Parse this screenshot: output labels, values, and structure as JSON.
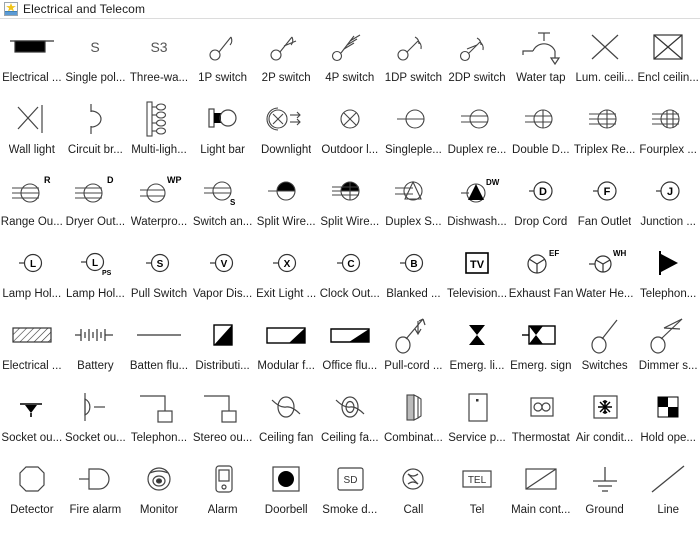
{
  "window": {
    "title": "Electrical and Telecom",
    "icon": "library-star-icon"
  },
  "colors": {
    "stroke": "#3a3a3a",
    "fill_black": "#000000",
    "text": "#1d1d1d",
    "accent_star": "#f0c419",
    "accent_band": "#5b9bd5"
  },
  "palette": {
    "columns": 11,
    "rows": 7,
    "items": [
      {
        "label": "Electrical ...",
        "icon": "electrical-panel-icon"
      },
      {
        "label": "Single pol...",
        "icon": "single-pole-switch-s-icon"
      },
      {
        "label": "Three-wa...",
        "icon": "three-way-switch-s3-icon"
      },
      {
        "label": "1P switch",
        "icon": "1p-switch-icon"
      },
      {
        "label": "2P switch",
        "icon": "2p-switch-icon"
      },
      {
        "label": "4P switch",
        "icon": "4p-switch-icon"
      },
      {
        "label": "1DP switch",
        "icon": "1dp-switch-icon"
      },
      {
        "label": "2DP switch",
        "icon": "2dp-switch-icon"
      },
      {
        "label": "Water tap",
        "icon": "water-tap-icon"
      },
      {
        "label": "Lum. ceili...",
        "icon": "luminaire-ceiling-icon"
      },
      {
        "label": "Encl ceilin...",
        "icon": "enclosed-ceiling-icon"
      },
      {
        "label": "Wall light",
        "icon": "wall-light-icon"
      },
      {
        "label": "Circuit br...",
        "icon": "circuit-breaker-icon"
      },
      {
        "label": "Multi-ligh...",
        "icon": "multi-light-track-icon"
      },
      {
        "label": "Light bar",
        "icon": "light-bar-icon"
      },
      {
        "label": "Downlight",
        "icon": "downlight-icon"
      },
      {
        "label": "Outdoor l...",
        "icon": "outdoor-light-icon"
      },
      {
        "label": "Singleple...",
        "icon": "single-receptacle-icon"
      },
      {
        "label": "Duplex re...",
        "icon": "duplex-receptacle-icon"
      },
      {
        "label": "Double D...",
        "icon": "double-duplex-receptacle-icon"
      },
      {
        "label": "Triplex Re...",
        "icon": "triplex-receptacle-icon"
      },
      {
        "label": "Fourplex ...",
        "icon": "fourplex-receptacle-icon"
      },
      {
        "label": "Range Ou...",
        "icon": "range-outlet-r-icon"
      },
      {
        "label": "Dryer Out...",
        "icon": "dryer-outlet-d-icon"
      },
      {
        "label": "Waterpro...",
        "icon": "waterproof-outlet-wp-icon"
      },
      {
        "label": "Switch an...",
        "icon": "switch-and-outlet-s-icon"
      },
      {
        "label": "Split Wire...",
        "icon": "split-wired-duplex-icon"
      },
      {
        "label": "Split Wire...",
        "icon": "split-wired-triplex-icon"
      },
      {
        "label": "Duplex S...",
        "icon": "duplex-special-triangle-icon"
      },
      {
        "label": "Dishwash...",
        "icon": "dishwasher-dw-icon"
      },
      {
        "label": "Drop Cord",
        "icon": "drop-cord-d-icon"
      },
      {
        "label": "Fan Outlet",
        "icon": "fan-outlet-f-icon"
      },
      {
        "label": "Junction ...",
        "icon": "junction-box-j-icon"
      },
      {
        "label": "Lamp Hol...",
        "icon": "lamp-holder-l-icon"
      },
      {
        "label": "Lamp Hol...",
        "icon": "lamp-holder-ps-icon"
      },
      {
        "label": "Pull Switch",
        "icon": "pull-switch-s-icon"
      },
      {
        "label": "Vapor Dis...",
        "icon": "vapor-discharge-v-icon"
      },
      {
        "label": "Exit Light ...",
        "icon": "exit-light-x-icon"
      },
      {
        "label": "Clock Out...",
        "icon": "clock-outlet-c-icon"
      },
      {
        "label": "Blanked ...",
        "icon": "blanked-outlet-b-icon"
      },
      {
        "label": "Television...",
        "icon": "television-outlet-tv-icon"
      },
      {
        "label": "Exhaust Fan",
        "icon": "exhaust-fan-ef-icon"
      },
      {
        "label": "Water He...",
        "icon": "water-heater-wh-icon"
      },
      {
        "label": "Telephon...",
        "icon": "telephone-jack-icon"
      },
      {
        "label": "Electrical ...",
        "icon": "electrical-hatched-box-icon"
      },
      {
        "label": "Battery",
        "icon": "battery-icon"
      },
      {
        "label": "Batten flu...",
        "icon": "batten-fluorescent-icon"
      },
      {
        "label": "Distributi...",
        "icon": "distribution-board-icon"
      },
      {
        "label": "Modular f...",
        "icon": "modular-fluorescent-icon"
      },
      {
        "label": "Office flu...",
        "icon": "office-fluorescent-icon"
      },
      {
        "label": "Pull-cord ...",
        "icon": "pull-cord-switch-icon"
      },
      {
        "label": "Emerg. li...",
        "icon": "emergency-light-icon"
      },
      {
        "label": "Emerg. sign",
        "icon": "emergency-sign-icon"
      },
      {
        "label": "Switches",
        "icon": "switches-icon"
      },
      {
        "label": "Dimmer s...",
        "icon": "dimmer-switch-icon"
      },
      {
        "label": "Socket ou...",
        "icon": "socket-outlet-icon"
      },
      {
        "label": "Socket ou...",
        "icon": "socket-outlet-switched-icon"
      },
      {
        "label": "Telephon...",
        "icon": "telephone-outlet-icon"
      },
      {
        "label": "Stereo ou...",
        "icon": "stereo-outlet-icon"
      },
      {
        "label": "Ceiling fan",
        "icon": "ceiling-fan-icon"
      },
      {
        "label": "Ceiling fa...",
        "icon": "ceiling-fan-light-icon"
      },
      {
        "label": "Combinat...",
        "icon": "combination-unit-icon"
      },
      {
        "label": "Service p...",
        "icon": "service-panel-icon"
      },
      {
        "label": "Thermostat",
        "icon": "thermostat-icon"
      },
      {
        "label": "Air condit...",
        "icon": "air-conditioner-icon"
      },
      {
        "label": "Hold ope...",
        "icon": "hold-open-device-icon"
      },
      {
        "label": "Detector",
        "icon": "detector-icon"
      },
      {
        "label": "Fire alarm",
        "icon": "fire-alarm-icon"
      },
      {
        "label": "Monitor",
        "icon": "monitor-camera-icon"
      },
      {
        "label": "Alarm",
        "icon": "alarm-panel-icon"
      },
      {
        "label": "Doorbell",
        "icon": "doorbell-icon"
      },
      {
        "label": "Smoke d...",
        "icon": "smoke-detector-sd-icon"
      },
      {
        "label": "Call",
        "icon": "call-point-icon"
      },
      {
        "label": "Tel",
        "icon": "telephone-tel-icon"
      },
      {
        "label": "Main cont...",
        "icon": "main-contactor-icon"
      },
      {
        "label": "Ground",
        "icon": "ground-icon"
      },
      {
        "label": "Line",
        "icon": "line-icon"
      }
    ]
  }
}
